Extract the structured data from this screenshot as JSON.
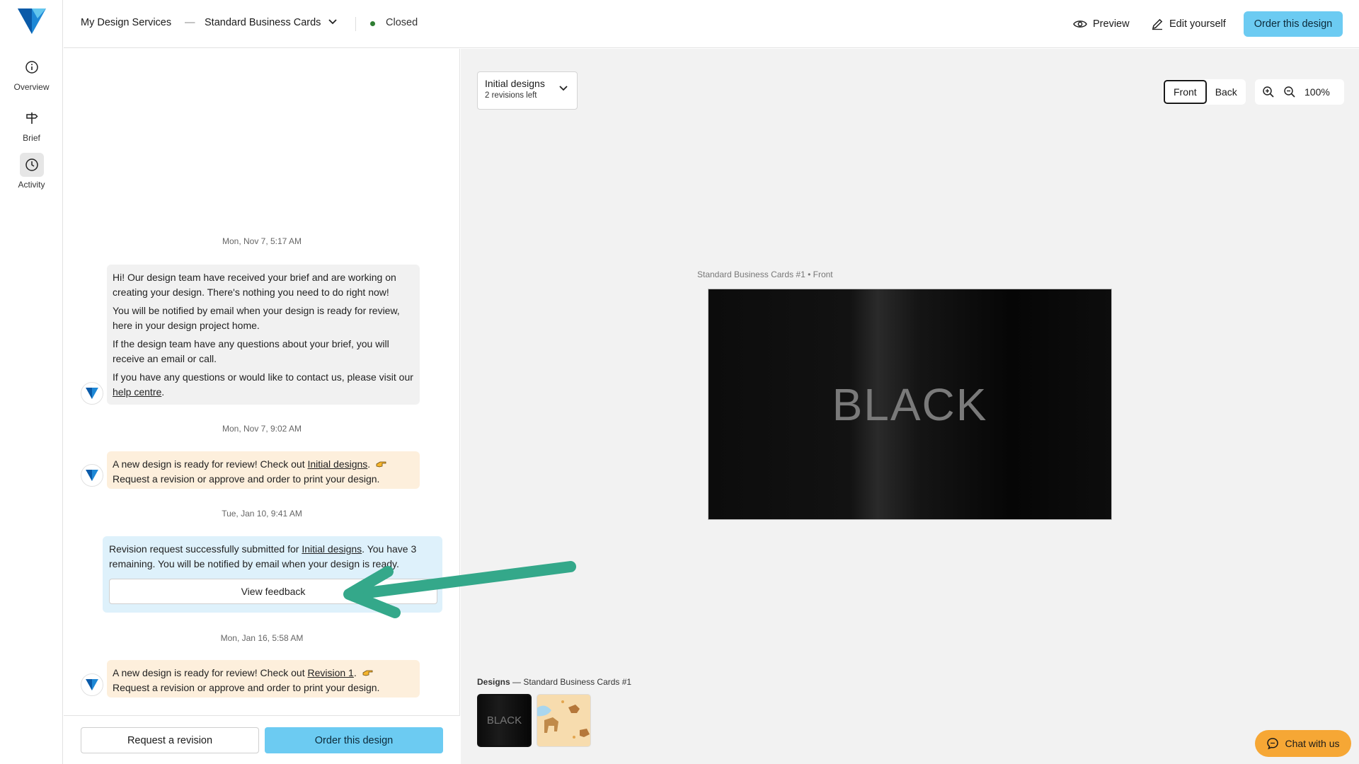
{
  "nav": {
    "items": [
      {
        "label": "Overview",
        "icon": "info-icon"
      },
      {
        "label": "Brief",
        "icon": "signpost-icon"
      },
      {
        "label": "Activity",
        "icon": "clock-icon"
      }
    ]
  },
  "topbar": {
    "breadcrumb_root": "My Design Services",
    "breadcrumb_sep": "—",
    "product": "Standard Business Cards",
    "status": "Closed",
    "status_color": "#2e7d32",
    "preview": "Preview",
    "edit": "Edit yourself",
    "order": "Order this design"
  },
  "chat": {
    "messages": [
      {
        "date": "Mon, Nov 7, 5:17 AM",
        "p1": "Hi! Our design team have received your brief and are working on creating your design. There's nothing you need to do right now!",
        "p2": "You will be notified by email when your design is ready for review, here in your design project home.",
        "p3": "If the design team have any questions about your brief, you will receive an email or call.",
        "p4_prefix": "If you have any questions or would like to contact us, please visit our ",
        "p4_link": "help centre",
        "p4_suffix": "."
      },
      {
        "date": "Mon, Nov 7, 9:02 AM",
        "prefix": "A new design is ready for review! Check out ",
        "link": "Initial designs",
        "suffix": ".",
        "line2": "Request a revision or approve and order to print your design."
      },
      {
        "date": "Tue, Jan 10, 9:41 AM",
        "prefix": "Revision request successfully submitted for ",
        "link": "Initial designs",
        "suffix": ". You have 3 remaining. You will be notified by email when your design is ready.",
        "button": "View feedback"
      },
      {
        "date": "Mon, Jan 16, 5:58 AM",
        "prefix": "A new design is ready for review! Check out ",
        "link": "Revision 1",
        "suffix": ".",
        "line2": "Request a revision or approve and order to print your design."
      }
    ],
    "footer": {
      "request": "Request a revision",
      "order": "Order this design"
    }
  },
  "canvas": {
    "revision_title": "Initial designs",
    "revision_sub": "2 revisions left",
    "side_front": "Front",
    "side_back": "Back",
    "zoom": "100%",
    "card_label": "Standard Business Cards #1 • Front",
    "card_text": "BLACK",
    "designs_label_bold": "Designs",
    "designs_label_rest": " — Standard Business Cards #1",
    "thumb1_text": "BLACK",
    "chat_button": "Chat with us"
  },
  "colors": {
    "accent": "#6ccbf2",
    "chat_button": "#f6a735",
    "arrow": "#34a88a"
  }
}
